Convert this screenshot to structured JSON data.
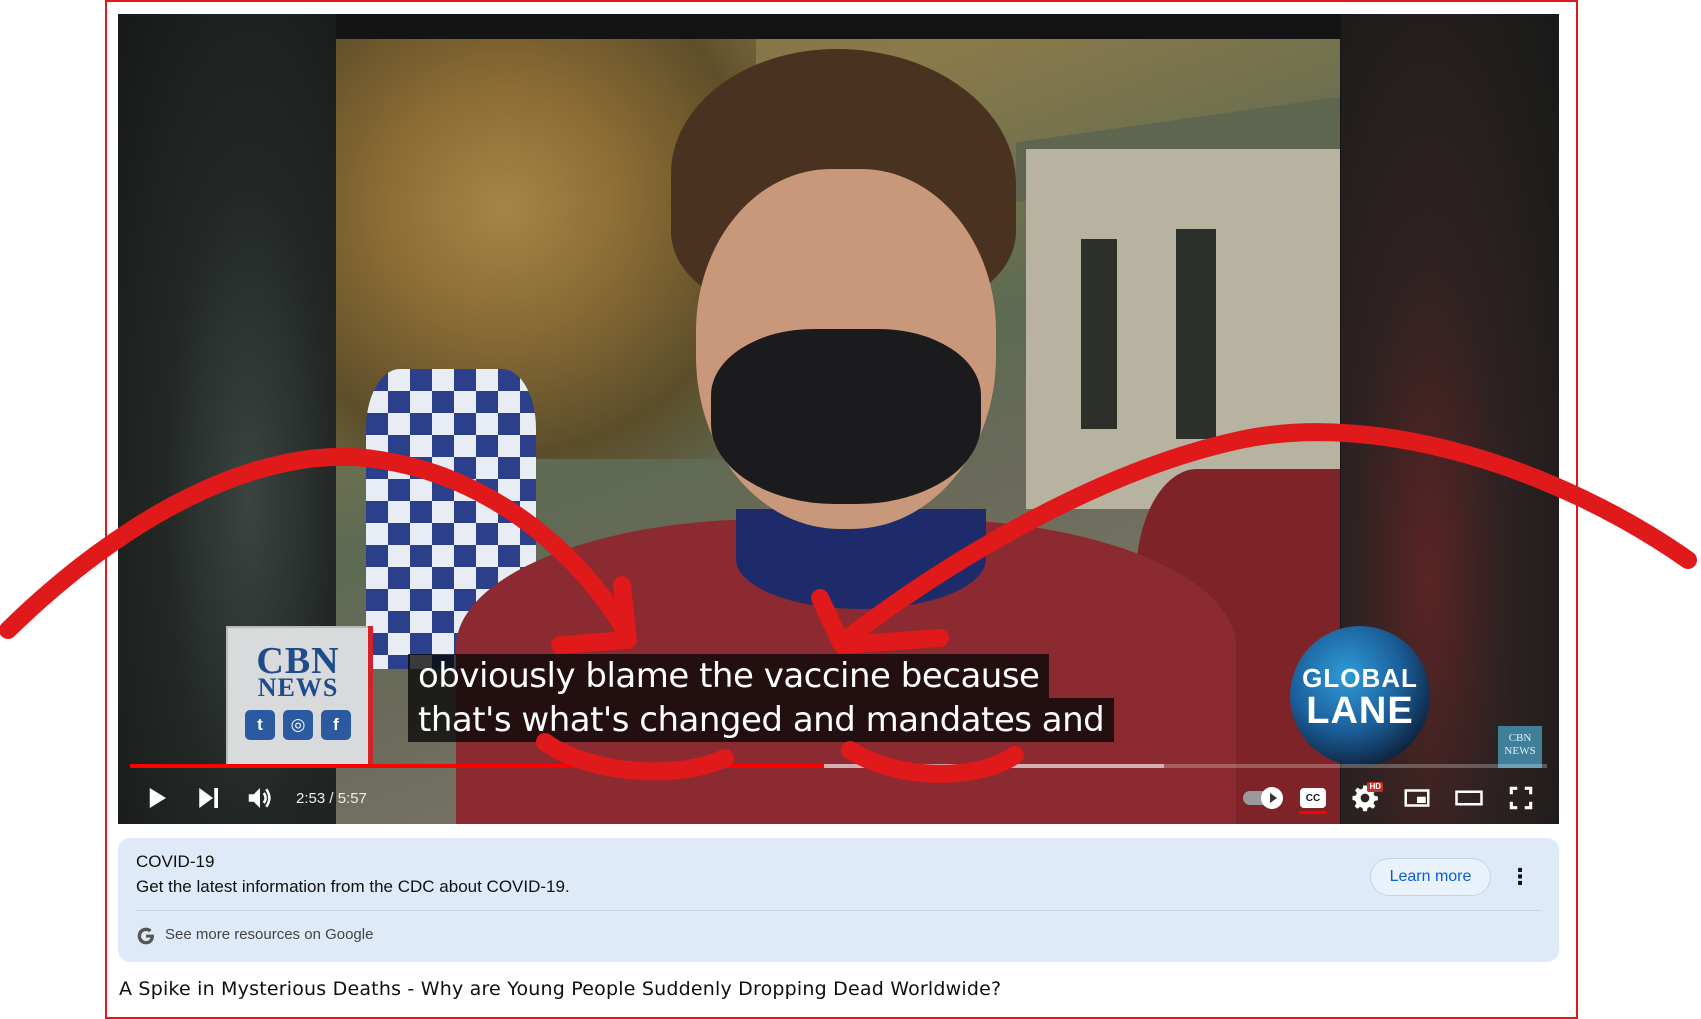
{
  "player": {
    "caption_lines": [
      "obviously blame the vaccine because",
      "that's what's changed and mandates and"
    ],
    "time_display": "2:53 / 5:57",
    "played_fraction": 0.49,
    "buffered_fraction": 0.73,
    "logo_left": {
      "line1": "CBN",
      "line2": "NEWS"
    },
    "logo_right": {
      "line1": "GLOBAL",
      "line2": "LANE"
    },
    "watermark": "CBN NEWS",
    "icons": [
      "play-icon",
      "next-icon",
      "volume-icon",
      "autoplay-toggle-icon",
      "captions-icon",
      "settings-icon",
      "miniplayer-icon",
      "theater-icon",
      "fullscreen-icon"
    ],
    "cc_label": "CC",
    "hd_badge": "HD"
  },
  "info_panel": {
    "title": "COVID-19",
    "subtitle": "Get the latest information from the CDC about COVID-19.",
    "learn_more": "Learn more",
    "more_resources": "See more resources on Google"
  },
  "video_title": "A Spike in Mysterious Deaths - Why are Young People Suddenly Dropping Dead Worldwide?",
  "colors": {
    "annotation": "#e0191b",
    "progress": "#ff0000",
    "panel": "#deeaf8",
    "link": "#065fd4"
  }
}
